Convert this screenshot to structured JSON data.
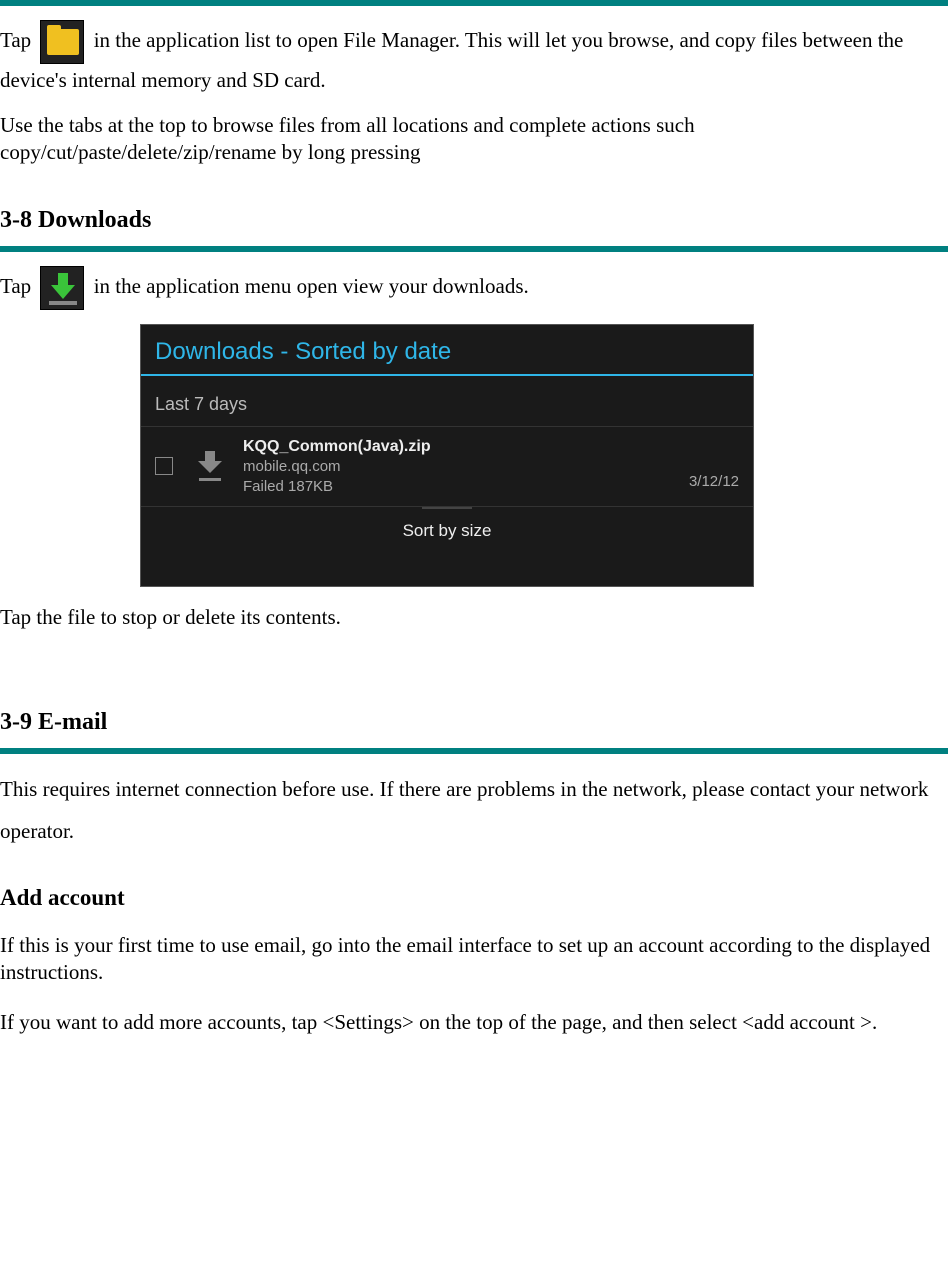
{
  "file_manager": {
    "tap_prefix": "Tap ",
    "tap_suffix": " in the application list to open File Manager. This will let you browse, and copy files between the device's internal memory and SD card.",
    "tabs_text": "Use the tabs at the top to browse files from all locations and complete actions such copy/cut/paste/delete/zip/rename by long pressing"
  },
  "downloads": {
    "heading": "3-8 Downloads",
    "tap_prefix": "Tap ",
    "tap_suffix": " in the application menu open view your downloads.",
    "post_text": "Tap the file to stop or delete its contents.",
    "screenshot": {
      "title": "Downloads - Sorted by date",
      "group": "Last 7 days",
      "file": {
        "name": "KQQ_Common(Java).zip",
        "source": "mobile.qq.com",
        "status": "Failed   187KB",
        "date": "3/12/12"
      },
      "sort_button": "Sort by size"
    }
  },
  "email": {
    "heading": "3-9 E-mail",
    "intro": "This requires internet connection before use. If there are problems in the network, please contact your network operator.",
    "add_account_heading": "Add account",
    "first_time": "If this is your first time to use email, go into the email interface to set up an account according to the displayed instructions.",
    "more_accounts": "If you want to add more accounts, tap <Settings> on the top of the page, and then select <add account >."
  }
}
